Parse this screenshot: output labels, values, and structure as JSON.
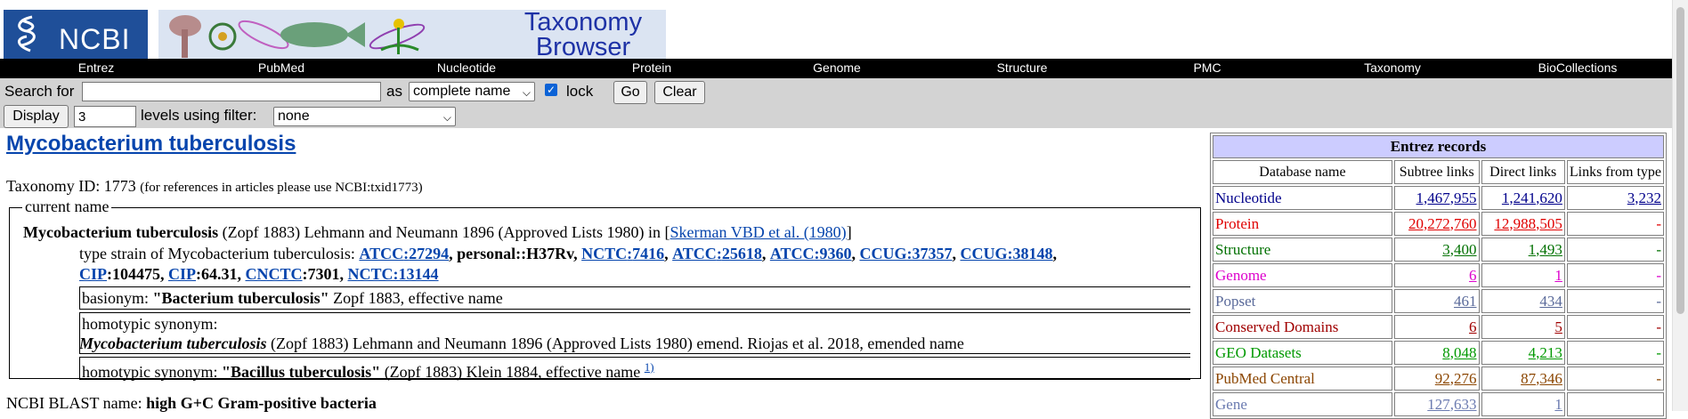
{
  "header": {
    "ncbi_logo_text": "NCBI",
    "banner_title_line1": "Taxonomy",
    "banner_title_line2": "Browser"
  },
  "nav": [
    {
      "label": "Entrez"
    },
    {
      "label": "PubMed"
    },
    {
      "label": "Nucleotide"
    },
    {
      "label": "Protein"
    },
    {
      "label": "Genome"
    },
    {
      "label": "Structure"
    },
    {
      "label": "PMC"
    },
    {
      "label": "Taxonomy"
    },
    {
      "label": "BioCollections"
    }
  ],
  "search": {
    "search_for_label": "Search for",
    "search_value": "",
    "as_label": "as",
    "mode_selected": "complete name",
    "lock_label": "lock",
    "lock_checked": true,
    "go_label": "Go",
    "clear_label": "Clear",
    "display_label": "Display",
    "levels_value": "3",
    "levels_label": "levels using filter:",
    "filter_selected": "none"
  },
  "organism": {
    "title": "Mycobacterium tuberculosis",
    "taxid_label": "Taxonomy ID: 1773",
    "taxid_note": "(for references in articles please use NCBI:txid1773)",
    "legend": "current name",
    "current_name_bold": "Mycobacterium tuberculosis",
    "current_name_rest": " (Zopf 1883) Lehmann and Neumann 1896 (Approved Lists 1980) in [",
    "current_name_ref": "Skerman VBD et al. (1980)",
    "current_name_close": "]",
    "type_strain_prefix": "type strain of Mycobacterium tuberculosis:",
    "strains": [
      {
        "coll": "ATCC",
        "num": "27294",
        "linked": true
      },
      {
        "coll": "personal",
        "num": "H37Rv",
        "linked": false,
        "sep": "::"
      },
      {
        "coll": "NCTC",
        "num": "7416",
        "linked": true
      },
      {
        "coll": "ATCC",
        "num": "25618",
        "linked": true
      },
      {
        "coll": "ATCC",
        "num": "9360",
        "linked": true
      },
      {
        "coll": "CCUG",
        "num": "37357",
        "linked": true
      },
      {
        "coll": "CCUG",
        "num": "38148",
        "linked": true
      },
      {
        "coll": "CIP",
        "num": "104475",
        "linked": "coll"
      },
      {
        "coll": "CIP",
        "num": "64.31",
        "linked": "coll"
      },
      {
        "coll": "CNCTC",
        "num": "7301",
        "linked": "coll"
      },
      {
        "coll": "NCTC",
        "num": "13144",
        "linked": true
      }
    ],
    "basionym_label": "basionym:",
    "basionym_name": "\"Bacterium tuberculosis\"",
    "basionym_rest": " Zopf 1883, effective name",
    "homotypic1_label": "homotypic synonym:",
    "homotypic1_name": "Mycobacterium tuberculosis",
    "homotypic1_rest": " (Zopf 1883) Lehmann and Neumann 1896 (Approved Lists 1980) emend. Riojas et al. 2018, emended name",
    "homotypic2_label": "homotypic synonym:",
    "homotypic2_name": "\"Bacillus tuberculosis\"",
    "homotypic2_rest": " (Zopf 1883) Klein 1884, effective name",
    "homotypic2_footnote": "1)",
    "blast_label": "NCBI BLAST name:",
    "blast_value": "high G+C Gram-positive bacteria"
  },
  "entrez": {
    "title": "Entrez records",
    "headers": [
      "Database name",
      "Subtree links",
      "Direct links",
      "Links from type"
    ],
    "rows": [
      {
        "name": "Nucleotide",
        "subtree": "1,467,955",
        "direct": "1,241,620",
        "type": "3,232",
        "color": "#00008b"
      },
      {
        "name": "Protein",
        "subtree": "20,272,760",
        "direct": "12,988,505",
        "type": "-",
        "color": "#e00000"
      },
      {
        "name": "Structure",
        "subtree": "3,400",
        "direct": "1,493",
        "type": "-",
        "color": "#007000"
      },
      {
        "name": "Genome",
        "subtree": "6",
        "direct": "1",
        "type": "-",
        "color": "#dd00cc"
      },
      {
        "name": "Popset",
        "subtree": "461",
        "direct": "434",
        "type": "-",
        "color": "#5a6a9a"
      },
      {
        "name": "Conserved Domains",
        "subtree": "6",
        "direct": "5",
        "type": "-",
        "color": "#a00000"
      },
      {
        "name": "GEO Datasets",
        "subtree": "8,048",
        "direct": "4,213",
        "type": "-",
        "color": "#009900"
      },
      {
        "name": "PubMed Central",
        "subtree": "92,276",
        "direct": "87,346",
        "type": "-",
        "color": "#8b4500"
      },
      {
        "name": "Gene",
        "subtree": "127,633",
        "direct": "1",
        "type": "",
        "color": "#6a7ab0"
      }
    ]
  }
}
